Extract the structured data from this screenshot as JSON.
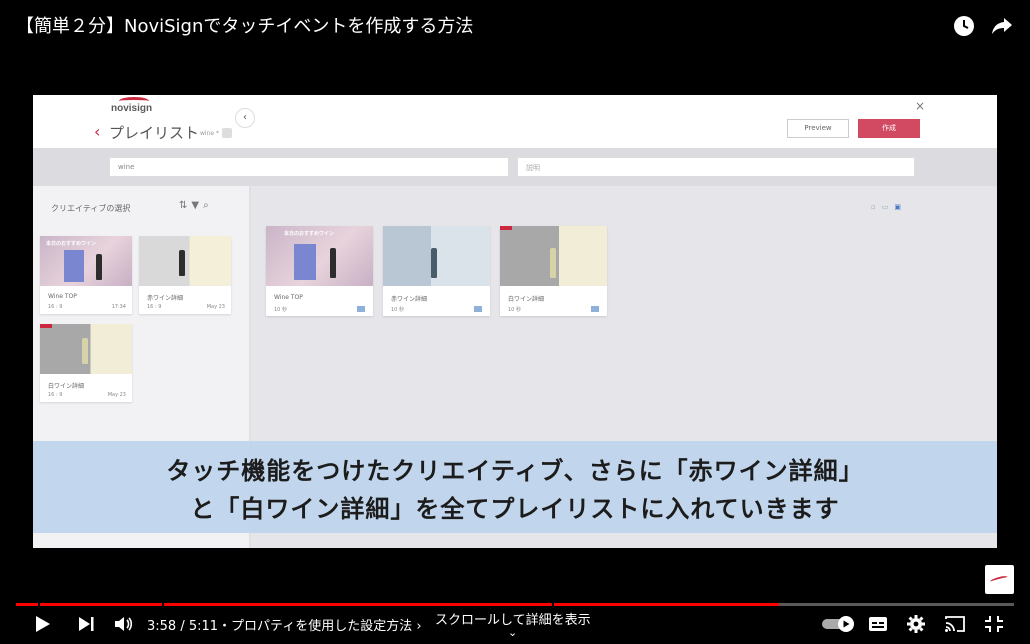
{
  "video": {
    "title": "【簡単２分】NoviSignでタッチイベントを作成する方法",
    "subtitle_line1": "タッチ機能をつけたクリエイティブ、さらに「赤ワイン詳細」",
    "subtitle_line2": "と「白ワイン詳細」を全てプレイリストに入れていきます"
  },
  "app": {
    "logo_text": "novisign",
    "page_title": "プレイリスト",
    "page_sub": "wine *",
    "preview_label": "Preview",
    "create_label": "作成",
    "search_value": "wine",
    "second_field_placeholder": "説明",
    "left_panel_title": "クリエイティブの選択",
    "left_cards": [
      {
        "name": "Wine TOP",
        "meta": "16 : 9",
        "date": "17:34",
        "thumb_label": "本日のおすすめワイン"
      },
      {
        "name": "赤ワイン詳細",
        "meta": "16 : 9",
        "date": "May 23"
      },
      {
        "name": "白ワイン詳細",
        "meta": "16 : 9",
        "date": "May 23"
      }
    ],
    "playlist_cards": [
      {
        "name": "Wine TOP",
        "duration": "10 秒",
        "thumb_label": "本日のおすすめワイン"
      },
      {
        "name": "赤ワイン詳細",
        "duration": "10 秒"
      },
      {
        "name": "白ワイン詳細",
        "duration": "10 秒"
      }
    ]
  },
  "player": {
    "time": "3:58 / 5:11",
    "chapter": "・プロパティを使用した設定方法 ›",
    "scroll_hint": "スクロールして詳細を表示",
    "progress_fraction": 0.765,
    "accent": "#ff0000"
  }
}
